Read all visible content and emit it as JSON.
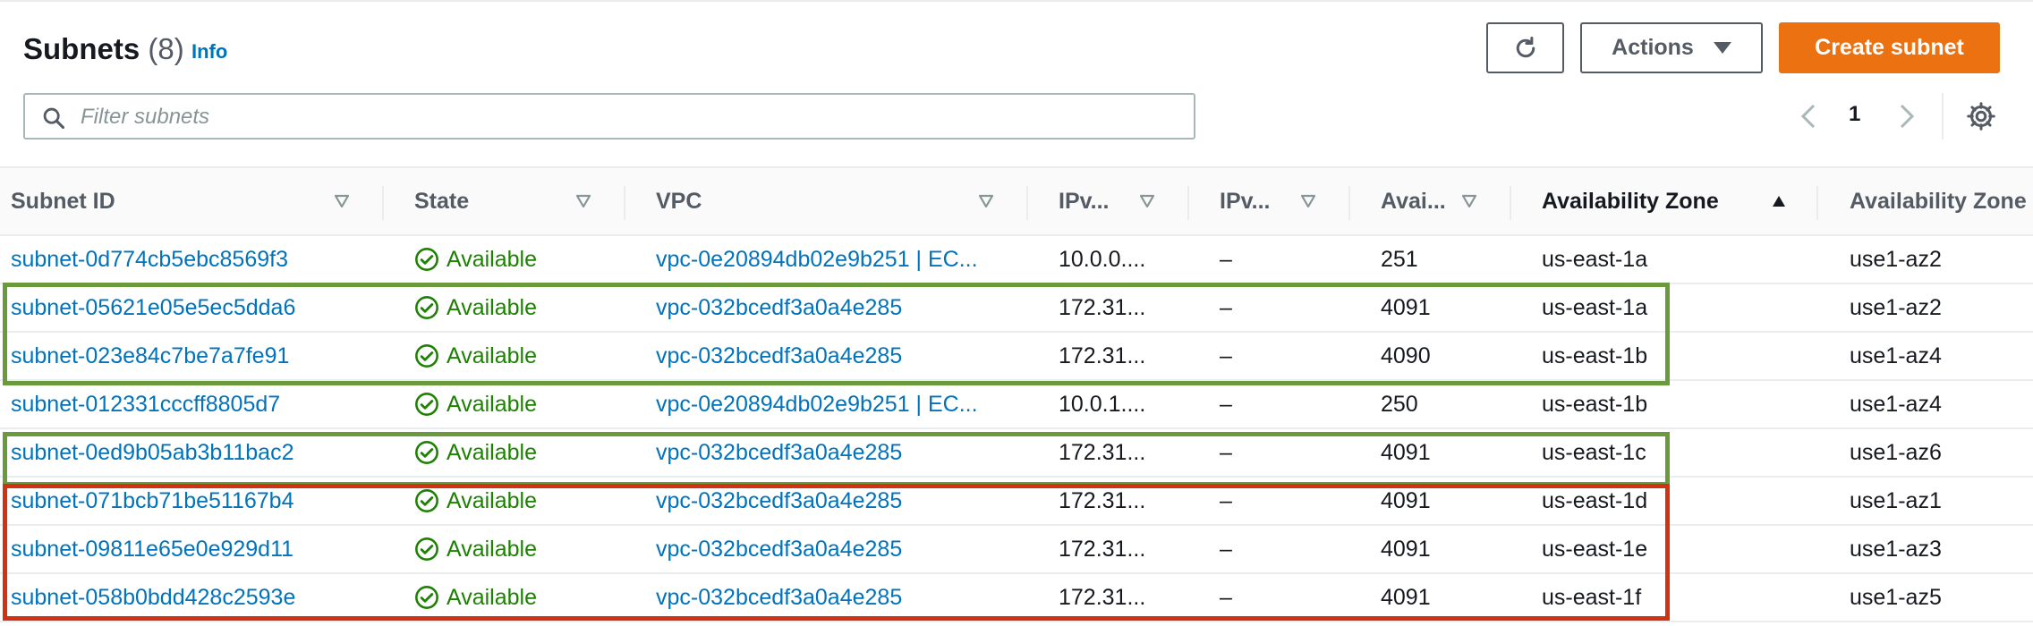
{
  "header": {
    "title": "Subnets",
    "count": "(8)",
    "info": "Info",
    "actions_label": "Actions",
    "create_label": "Create subnet",
    "refresh_icon": "refresh-icon"
  },
  "search": {
    "placeholder": "Filter subnets",
    "value": ""
  },
  "pagination": {
    "current_page": "1"
  },
  "table": {
    "columns": [
      {
        "label": "Subnet ID"
      },
      {
        "label": "State"
      },
      {
        "label": "VPC"
      },
      {
        "label": "IPv..."
      },
      {
        "label": "IPv..."
      },
      {
        "label": "Avai..."
      },
      {
        "label": "Availability Zone"
      },
      {
        "label": "Availability Zone"
      }
    ],
    "rows": [
      {
        "subnet_id": "subnet-0d774cb5ebc8569f3",
        "state": "Available",
        "vpc": "vpc-0e20894db02e9b251 | EC...",
        "ipv4": "10.0.0....",
        "ipv6": "–",
        "available_ips": "251",
        "az": "us-east-1a",
        "az_id": "use1-az2"
      },
      {
        "subnet_id": "subnet-05621e05e5ec5dda6",
        "state": "Available",
        "vpc": "vpc-032bcedf3a0a4e285",
        "ipv4": "172.31...",
        "ipv6": "–",
        "available_ips": "4091",
        "az": "us-east-1a",
        "az_id": "use1-az2"
      },
      {
        "subnet_id": "subnet-023e84c7be7a7fe91",
        "state": "Available",
        "vpc": "vpc-032bcedf3a0a4e285",
        "ipv4": "172.31...",
        "ipv6": "–",
        "available_ips": "4090",
        "az": "us-east-1b",
        "az_id": "use1-az4"
      },
      {
        "subnet_id": "subnet-012331cccff8805d7",
        "state": "Available",
        "vpc": "vpc-0e20894db02e9b251 | EC...",
        "ipv4": "10.0.1....",
        "ipv6": "–",
        "available_ips": "250",
        "az": "us-east-1b",
        "az_id": "use1-az4"
      },
      {
        "subnet_id": "subnet-0ed9b05ab3b11bac2",
        "state": "Available",
        "vpc": "vpc-032bcedf3a0a4e285",
        "ipv4": "172.31...",
        "ipv6": "–",
        "available_ips": "4091",
        "az": "us-east-1c",
        "az_id": "use1-az6"
      },
      {
        "subnet_id": "subnet-071bcb71be51167b4",
        "state": "Available",
        "vpc": "vpc-032bcedf3a0a4e285",
        "ipv4": "172.31...",
        "ipv6": "–",
        "available_ips": "4091",
        "az": "us-east-1d",
        "az_id": "use1-az1"
      },
      {
        "subnet_id": "subnet-09811e65e0e929d11",
        "state": "Available",
        "vpc": "vpc-032bcedf3a0a4e285",
        "ipv4": "172.31...",
        "ipv6": "–",
        "available_ips": "4091",
        "az": "us-east-1e",
        "az_id": "use1-az3"
      },
      {
        "subnet_id": "subnet-058b0bdd428c2593e",
        "state": "Available",
        "vpc": "vpc-032bcedf3a0a4e285",
        "ipv4": "172.31...",
        "ipv6": "–",
        "available_ips": "4091",
        "az": "us-east-1f",
        "az_id": "use1-az5"
      }
    ]
  },
  "colors": {
    "link": "#0073bb",
    "available": "#1d8102",
    "primary_button": "#ec7211",
    "highlight_green": "#6b9a3c",
    "highlight_red": "#d13212"
  }
}
